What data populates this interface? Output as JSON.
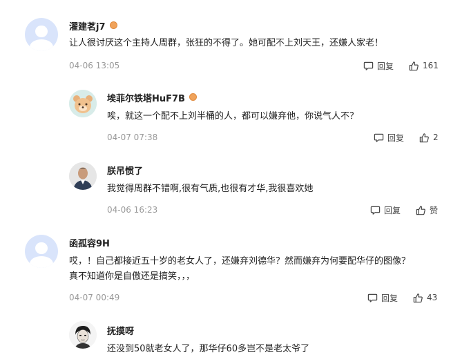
{
  "comments": [
    {
      "username": "濯建茗j7",
      "text": "让人很讨厌这个主持人周群，张狂的不得了。她可配不上刘天王，还嫌人家老！",
      "time": "04-06 13:05",
      "reply_label": "回复",
      "like_count": "161"
    },
    {
      "username": "埃菲尔铁塔HuF7B",
      "text": "唉，就这一个配不上刘半桶的人，都可以嫌弃他，你说气人不？",
      "time": "04-07 07:38",
      "reply_label": "回复",
      "like_count": "2"
    },
    {
      "username": "朕吊惯了",
      "text": "我觉得周群不错啊,很有气质,也很有才华,我很喜欢她",
      "time": "04-06 16:23",
      "reply_label": "回复",
      "like_count": "赞"
    },
    {
      "username": "函孤容9H",
      "text_line1": "哎，！自己都接近五十岁的老女人了，还嫌弃刘德华？然而嫌弃为何要配华仔的图像？",
      "text_line2": "真不知道你是自傲还是搞笑，，，",
      "time": "04-07 00:49",
      "reply_label": "回复",
      "like_count": "43"
    },
    {
      "username": "抚摸呀",
      "text": "还没到50就老女人了，那华仔60多岂不是老太爷了"
    }
  ],
  "icons": {
    "reply": "comment-bubble-icon",
    "like": "thumbs-up-icon",
    "badge": "level-badge-icon"
  },
  "colors": {
    "badge": "#f0a35b",
    "meta_text": "#9a9a9a",
    "avatar_default_bg": "#d9e4fb"
  }
}
